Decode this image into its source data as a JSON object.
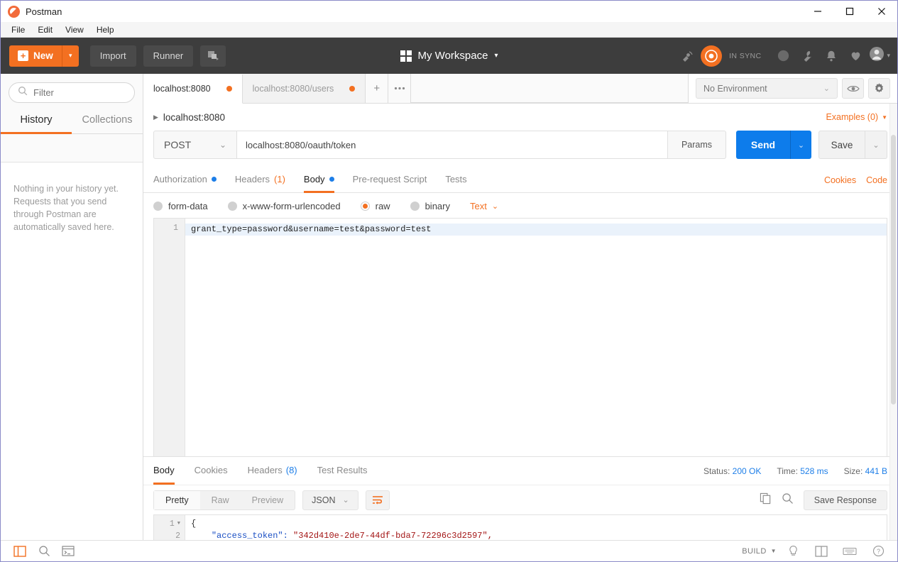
{
  "window": {
    "app_title": "Postman",
    "minimize": "—",
    "maximize": "□",
    "close": "✕"
  },
  "menubar": {
    "items": [
      "File",
      "Edit",
      "View",
      "Help"
    ]
  },
  "header": {
    "new_label": "New",
    "new_caret": "▾",
    "import_label": "Import",
    "runner_label": "Runner",
    "workspace_label": "My Workspace",
    "workspace_caret": "▾",
    "sync_status": "IN SYNC",
    "accent_color": "#f37021"
  },
  "sidebar": {
    "filter_placeholder": "Filter",
    "tabs": [
      {
        "label": "History",
        "active": true
      },
      {
        "label": "Collections",
        "active": false
      }
    ],
    "empty_text": "Nothing in your history yet. Requests that you send through Postman are automatically saved here."
  },
  "request_tabs": {
    "tabs": [
      {
        "label": "localhost:8080",
        "active": true,
        "unsaved": true
      },
      {
        "label": "localhost:8080/users",
        "active": false,
        "unsaved": true
      }
    ],
    "add_label": "+",
    "more_label": "•••"
  },
  "environment": {
    "selected": "No Environment",
    "caret": "⌄"
  },
  "request": {
    "name": "localhost:8080",
    "examples_label": "Examples (0)",
    "method": "POST",
    "method_caret": "⌄",
    "url": "localhost:8080/oauth/token",
    "params_label": "Params",
    "send_label": "Send",
    "send_caret": "⌄",
    "save_label": "Save",
    "save_caret": "⌄",
    "tabs": [
      {
        "label": "Authorization",
        "active": false,
        "dot": true,
        "count": ""
      },
      {
        "label": "Headers",
        "active": false,
        "dot": false,
        "count": "(1)"
      },
      {
        "label": "Body",
        "active": true,
        "dot": true,
        "count": ""
      },
      {
        "label": "Pre-request Script",
        "active": false,
        "dot": false,
        "count": ""
      },
      {
        "label": "Tests",
        "active": false,
        "dot": false,
        "count": ""
      }
    ],
    "cookies_link": "Cookies",
    "code_link": "Code",
    "body_types": [
      {
        "label": "form-data",
        "selected": false
      },
      {
        "label": "x-www-form-urlencoded",
        "selected": false
      },
      {
        "label": "raw",
        "selected": true
      },
      {
        "label": "binary",
        "selected": false
      }
    ],
    "raw_format": "Text",
    "raw_format_caret": "⌄",
    "body_line_number": "1",
    "body_content": "grant_type=password&username=test&password=test"
  },
  "response": {
    "tabs": [
      {
        "label": "Body",
        "active": true,
        "count": ""
      },
      {
        "label": "Cookies",
        "active": false,
        "count": ""
      },
      {
        "label": "Headers",
        "active": false,
        "count": "(8)"
      },
      {
        "label": "Test Results",
        "active": false,
        "count": ""
      }
    ],
    "status_label": "Status:",
    "status_value": "200 OK",
    "time_label": "Time:",
    "time_value": "528 ms",
    "size_label": "Size:",
    "size_value": "441 B",
    "view_modes": [
      {
        "label": "Pretty",
        "active": true
      },
      {
        "label": "Raw",
        "active": false
      },
      {
        "label": "Preview",
        "active": false
      }
    ],
    "format": "JSON",
    "format_caret": "⌄",
    "save_response_label": "Save Response",
    "body_lines": [
      {
        "number": "1",
        "foldable": true,
        "text": "{",
        "key": "",
        "value": ""
      },
      {
        "number": "2",
        "foldable": false,
        "text": "",
        "key": "\"access_token\":",
        "value": " \"342d410e-2de7-44df-bda7-72296c3d2597\","
      }
    ]
  },
  "statusbar": {
    "build_label": "BUILD",
    "build_caret": "▼"
  }
}
